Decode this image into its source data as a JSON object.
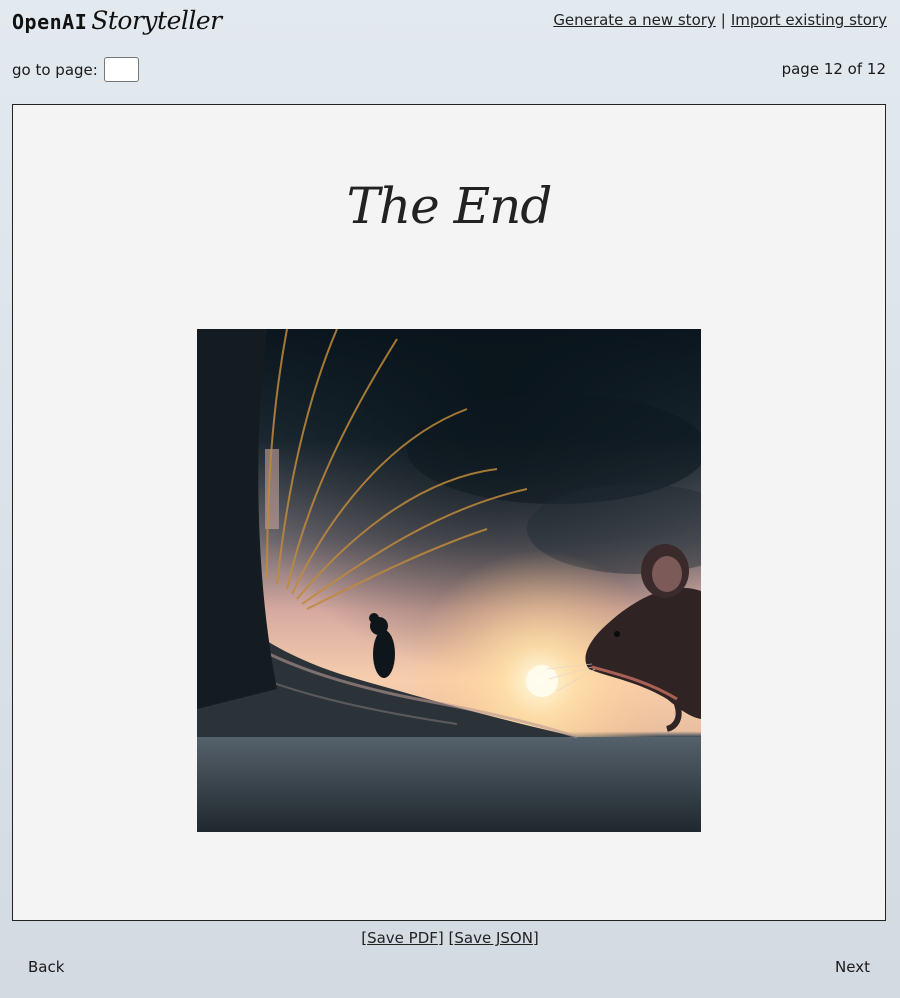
{
  "header": {
    "logo_brand": "OpenAI",
    "logo_product": "Storyteller",
    "generate_link": "Generate a new story",
    "separator": "|",
    "import_link": "Import existing story"
  },
  "navigation": {
    "goto_label": "go to page:",
    "goto_value": "",
    "page_indicator": "page 12 of 12",
    "current_page": 12,
    "total_pages": 12,
    "back_label": "Back",
    "next_label": "Next"
  },
  "page": {
    "title": "The End",
    "image_alt": "mouse-sunset-illustration"
  },
  "footer": {
    "open_bracket": "[",
    "save_pdf": "Save PDF",
    "middle_brackets": "] [",
    "save_json": "Save JSON",
    "close_bracket": "]"
  },
  "colors": {
    "background": "#dfe6ec",
    "page_background": "#f4f4f4",
    "border": "#222222",
    "sky_dark": "#0e1a22",
    "sunset_glow": "#ffd9a8",
    "ground": "#3e4b55"
  }
}
